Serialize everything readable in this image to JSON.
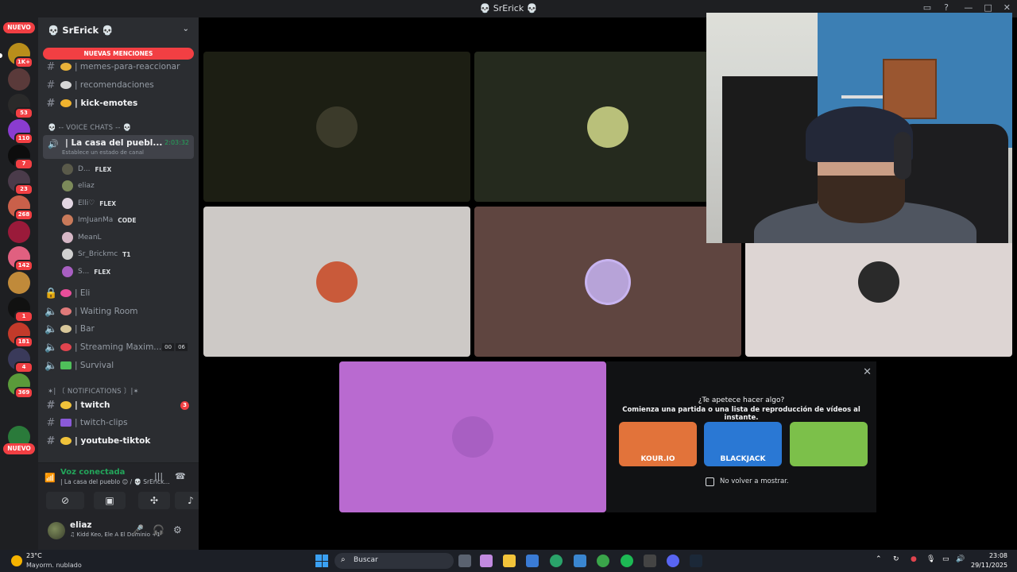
{
  "window": {
    "title": "💀 SrErick 💀"
  },
  "rail": {
    "nuevo_top": "NUEVO",
    "nuevo_bottom": "NUEVO",
    "servers": [
      {
        "badge": "1K+",
        "color": "#b98e1b"
      },
      {
        "badge": "",
        "color": "#5a3a3a"
      },
      {
        "badge": "53",
        "color": "#2a2a2a"
      },
      {
        "badge": "110",
        "color": "#8a3ccf"
      },
      {
        "badge": "7",
        "color": "#0d0d0d"
      },
      {
        "badge": "23",
        "color": "#4a3b4a"
      },
      {
        "badge": "268",
        "color": "#c9604a"
      },
      {
        "badge": "",
        "color": "#9a1a3a"
      },
      {
        "badge": "142",
        "color": "#e06080"
      },
      {
        "badge": "",
        "color": "#c08a3a"
      },
      {
        "badge": "1",
        "color": "#111111"
      },
      {
        "badge": "181",
        "color": "#c33a2a"
      },
      {
        "badge": "4",
        "color": "#3a3a5a"
      },
      {
        "badge": "369",
        "color": "#5a9a3a"
      },
      {
        "badge": "",
        "color": "#5865f2"
      },
      {
        "badge": "",
        "color": "#2a7a3a"
      }
    ]
  },
  "sidebar": {
    "guild_name": "💀 SrErick 💀",
    "new_mentions": "NUEVAS MENCIONES",
    "text_channels": [
      {
        "name": "| memes-para-reaccionar",
        "bold": false
      },
      {
        "name": "| recomendaciones",
        "bold": false
      },
      {
        "name": "| kick-emotes",
        "bold": true
      }
    ],
    "voice_category": "💀 -- VOICE CHATS -- 💀",
    "active_voice": {
      "name": "| La casa del puebl...",
      "status": "Establece un estado de canal",
      "timer": "2:03:32"
    },
    "members": [
      {
        "name": "D...",
        "tag": "FLEX"
      },
      {
        "name": "eliaz",
        "tag": ""
      },
      {
        "name": "Elli♡",
        "tag": "FLEX"
      },
      {
        "name": "ImJuanMa",
        "tag": "CODE"
      },
      {
        "name": "MeanL",
        "tag": ""
      },
      {
        "name": "Sr_Brickmc",
        "tag": "T1"
      },
      {
        "name": "S...",
        "tag": "FLEX"
      }
    ],
    "voice_channels": [
      {
        "name": "| Eli"
      },
      {
        "name": "| Waiting Room"
      },
      {
        "name": "| Bar"
      },
      {
        "name": "| Streaming Maxim...",
        "a": "00",
        "b": "06"
      },
      {
        "name": "| Survival"
      }
    ],
    "notif_category": "✶| 〔 NOTIFICATIONS 〕|✶",
    "notif_channels": [
      {
        "name": "| twitch",
        "count": "3",
        "bold": true
      },
      {
        "name": "| twitch-clips",
        "count": "",
        "bold": false
      },
      {
        "name": "| youtube-tiktok",
        "count": "",
        "bold": true
      }
    ]
  },
  "voice_panel": {
    "connected": "Voz conectada",
    "location": "| La casa del pueblo 😊 / 💀 SrErick..."
  },
  "user_panel": {
    "username": "eliaz",
    "activity": "♫ Kidd Keo, Ele A El Dominio +1"
  },
  "activity_prompt": {
    "title": "¿Te apetece hacer algo?",
    "subtitle": "Comienza una partida o una lista de reproducción de vídeos al instante.",
    "games": [
      {
        "label": "KOUR.IO",
        "color": "#e2733a"
      },
      {
        "label": "BLACKJACK",
        "color": "#2a78d4"
      },
      {
        "label": "",
        "color": "#7cc04a"
      }
    ],
    "dont_show": "No volver a mostrar."
  },
  "tiles": [
    {
      "bg": "#1c1e13",
      "avatar": "#3b3a2a"
    },
    {
      "bg": "#252a1e",
      "avatar": "#b9c07a"
    },
    {
      "bg": "#cdc9c6",
      "avatar": "#c95a3a"
    },
    {
      "bg": "#5f4540",
      "avatar": "#b7a3d8"
    },
    {
      "bg": "#ddd5d3",
      "avatar": "#2a2a2a"
    },
    {
      "bg": "#b96ad0",
      "avatar": "#a85fc2"
    }
  ],
  "taskbar": {
    "temp": "23°C",
    "weather": "Mayorm. nublado",
    "search": "Buscar",
    "time": "23:08",
    "date": "29/11/2025"
  }
}
